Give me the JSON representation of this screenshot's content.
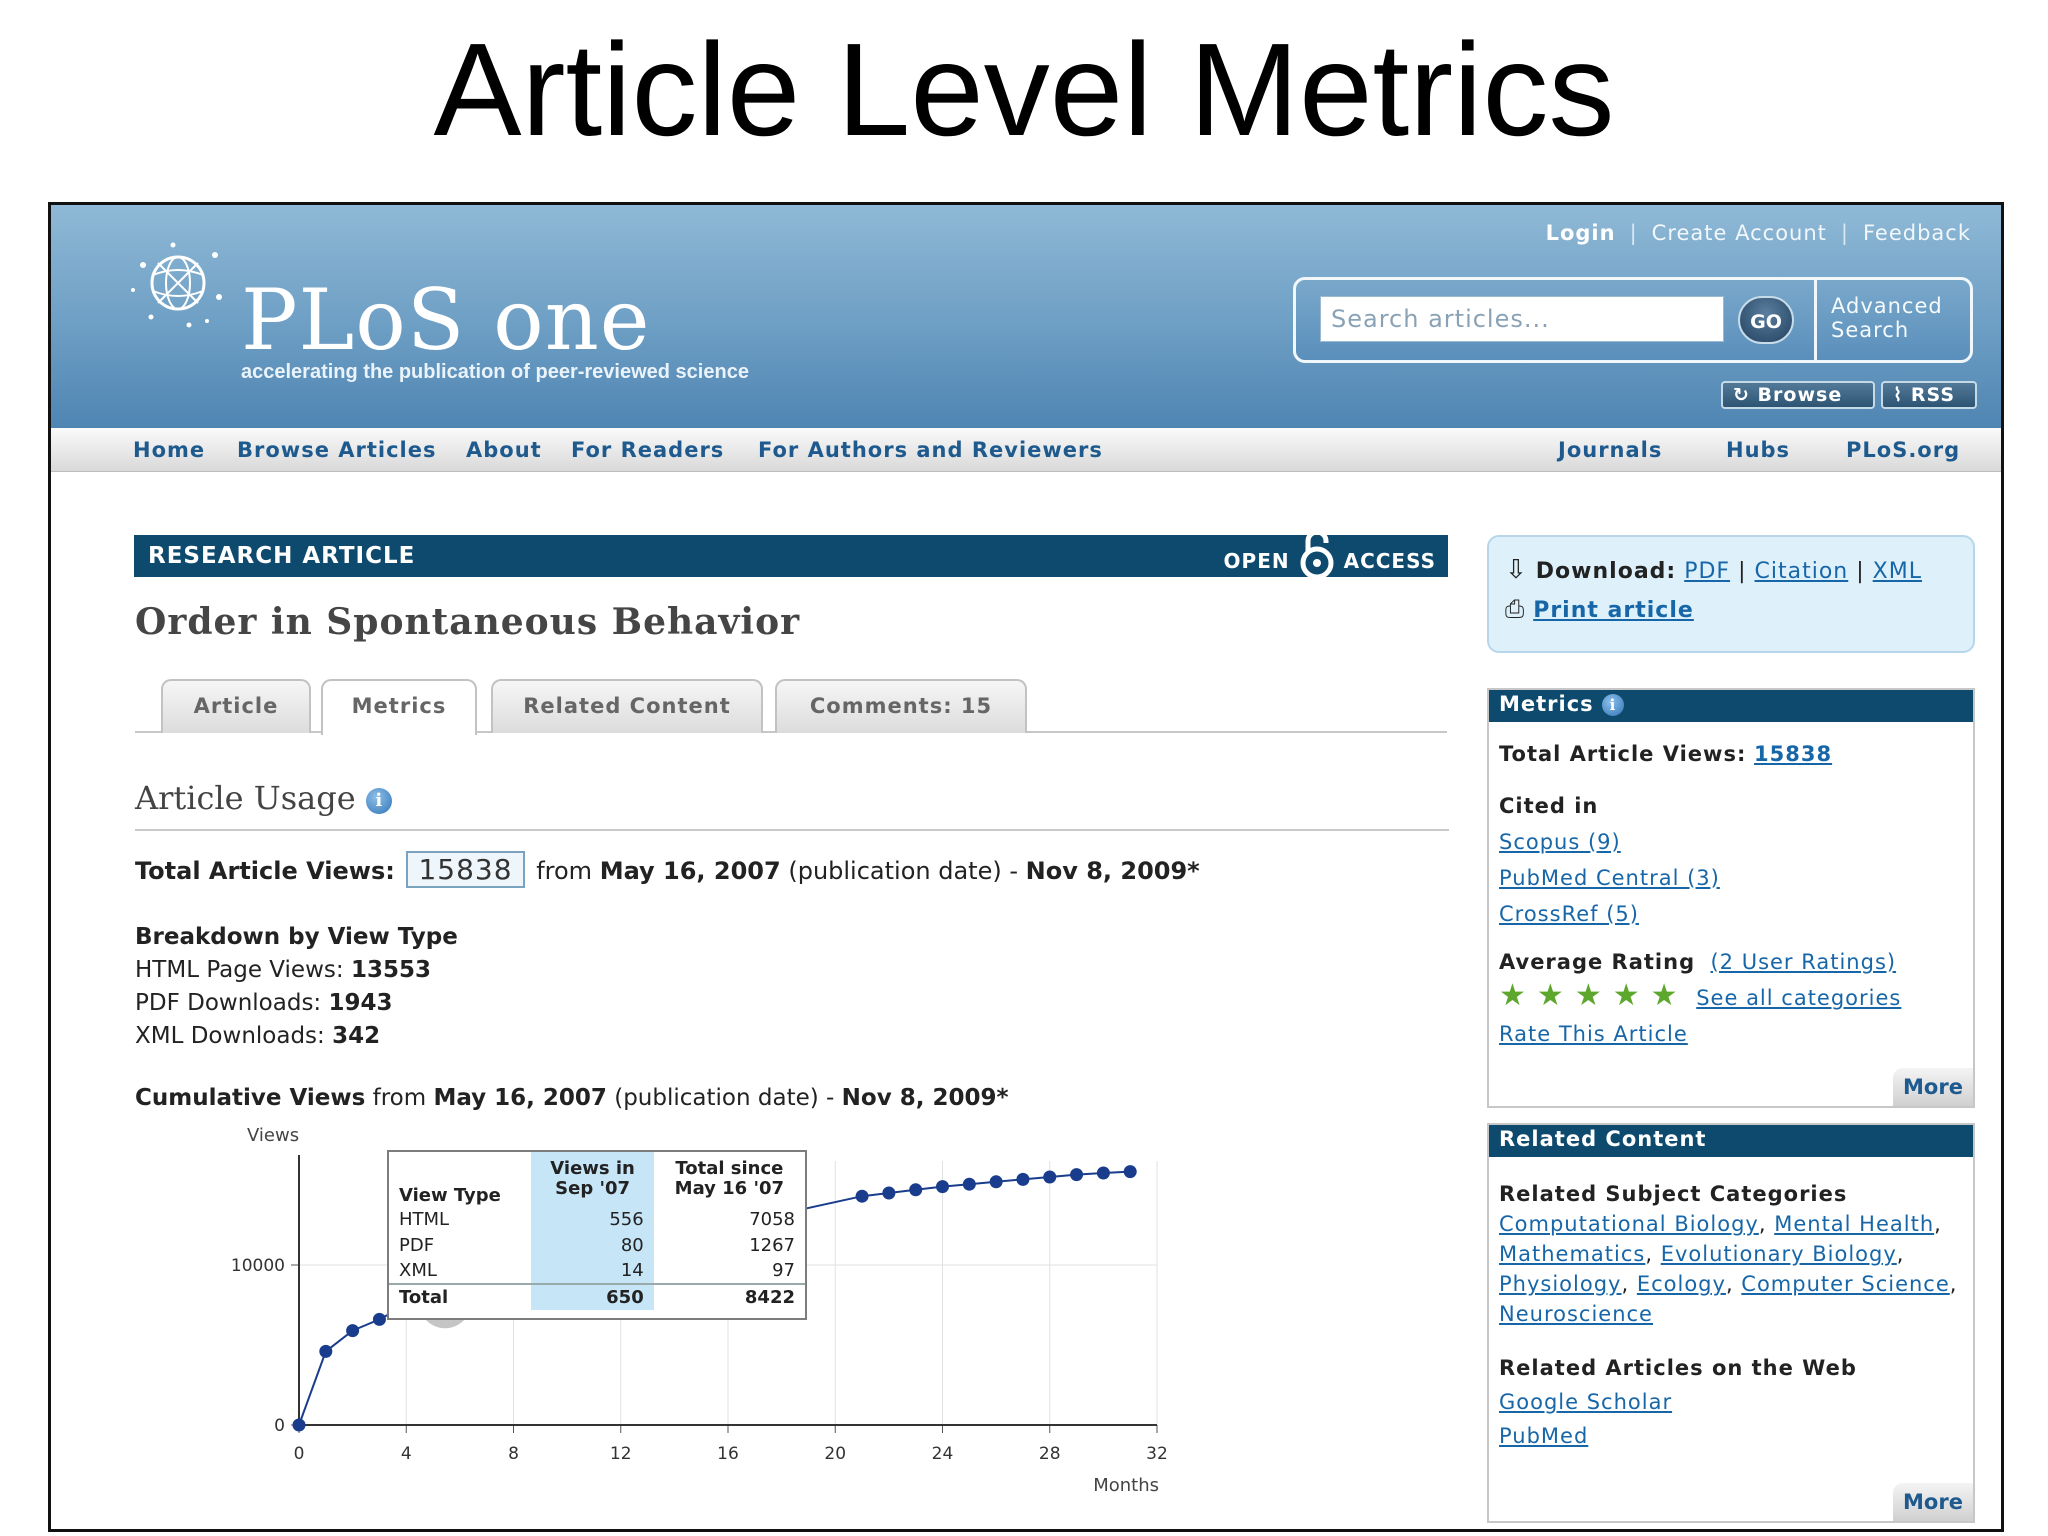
{
  "slide_title": "Article Level Metrics",
  "brand": {
    "logo_text": "PLoS one",
    "tagline": "accelerating the publication of peer-reviewed science"
  },
  "top_links": {
    "login": "Login",
    "create_account": "Create Account",
    "feedback": "Feedback",
    "separator": "|"
  },
  "search": {
    "placeholder": "Search articles...",
    "go": "GO",
    "advanced_1": "Advanced",
    "advanced_2": "Search"
  },
  "header_buttons": {
    "browse": "Browse",
    "rss": "RSS"
  },
  "nav": {
    "home": "Home",
    "browse_articles": "Browse Articles",
    "about": "About",
    "for_readers": "For Readers",
    "for_authors": "For Authors and Reviewers",
    "journals": "Journals",
    "hubs": "Hubs",
    "plos_org": "PLoS.org"
  },
  "article": {
    "type_label": "RESEARCH ARTICLE",
    "open": "OPEN",
    "access": "ACCESS",
    "title": "Order in Spontaneous Behavior"
  },
  "tabs": [
    "Article",
    "Metrics",
    "Related Content",
    "Comments: 15"
  ],
  "usage": {
    "heading": "Article Usage",
    "total_label": "Total Article Views:",
    "total_value": "15838",
    "from_word": "from",
    "start_date": "May 16, 2007",
    "pub_note": "(publication date) -",
    "end_date": "Nov 8, 2009*",
    "breakdown_heading": "Breakdown by View Type",
    "html_label": "HTML Page Views:",
    "html_value": "13553",
    "pdf_label": "PDF Downloads:",
    "pdf_value": "1943",
    "xml_label": "XML Downloads:",
    "xml_value": "342",
    "cumulative_label": "Cumulative Views",
    "cumulative_from": "from"
  },
  "tooltip": {
    "h1": "View Type",
    "h2a": "Views in",
    "h2b": "Sep '07",
    "h3a": "Total since",
    "h3b": "May 16 '07",
    "rows": [
      {
        "type": "HTML",
        "month": "556",
        "total": "7058"
      },
      {
        "type": "PDF",
        "month": "80",
        "total": "1267"
      },
      {
        "type": "XML",
        "month": "14",
        "total": "97"
      }
    ],
    "total": {
      "type": "Total",
      "month": "650",
      "total": "8422"
    }
  },
  "chart_data": {
    "type": "line",
    "title": "",
    "xlabel": "Months",
    "ylabel": "Views",
    "xlim": [
      0,
      32
    ],
    "ylim": [
      0,
      16500
    ],
    "xticks": [
      0,
      4,
      8,
      12,
      16,
      20,
      24,
      28,
      32
    ],
    "yticks": [
      0,
      10000
    ],
    "grid": true,
    "series": [
      {
        "values": [
          [
            0,
            0
          ],
          [
            1,
            4600
          ],
          [
            2,
            5900
          ],
          [
            3,
            6600
          ],
          [
            4,
            7500
          ],
          [
            5,
            8422
          ],
          [
            21,
            14300
          ],
          [
            22,
            14500
          ],
          [
            23,
            14700
          ],
          [
            24,
            14900
          ],
          [
            25,
            15050
          ],
          [
            26,
            15200
          ],
          [
            27,
            15350
          ],
          [
            28,
            15500
          ],
          [
            29,
            15650
          ],
          [
            30,
            15750
          ],
          [
            31,
            15838
          ]
        ],
        "highlight_x": 5,
        "color": "#1a3c8c"
      }
    ]
  },
  "download": {
    "label": "Download:",
    "pdf": "PDF",
    "citation": "Citation",
    "xml": "XML",
    "print": "Print article",
    "sep": "|"
  },
  "metrics_panel": {
    "title": "Metrics",
    "total_label": "Total Article Views:",
    "total_value": "15838",
    "cited_in": "Cited in",
    "scopus": "Scopus (9)",
    "pmc": "PubMed Central (3)",
    "crossref": "CrossRef (5)",
    "avg_rating": "Average Rating",
    "user_ratings": "(2 User Ratings)",
    "stars": 5,
    "see_all": "See all categories",
    "rate": "Rate This Article",
    "more": "More"
  },
  "related_panel": {
    "title": "Related Content",
    "subject_heading": "Related Subject Categories",
    "cats": [
      "Computational Biology",
      "Mental Health",
      "Mathematics",
      "Evolutionary Biology",
      "Physiology",
      "Ecology",
      "Computer Science",
      "Neuroscience"
    ],
    "web_heading": "Related Articles on the Web",
    "google": "Google Scholar",
    "pubmed": "PubMed",
    "more": "More"
  },
  "colors": {
    "header_blue": "#6d9ec4",
    "dark_teal": "#0e4a6e",
    "link": "#1766a8",
    "series": "#1a3c8c"
  }
}
